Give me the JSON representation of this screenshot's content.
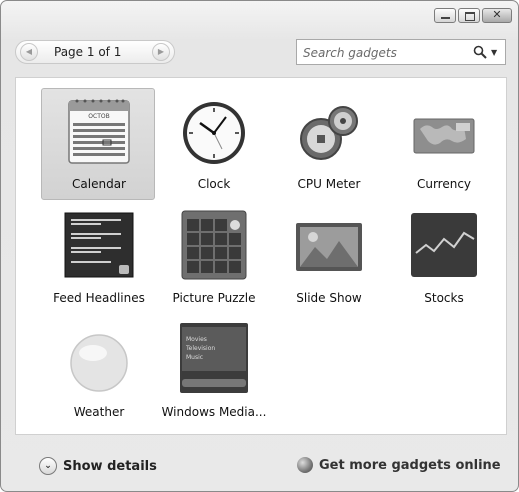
{
  "window": {
    "minimize_glyph": "—",
    "maximize_glyph": "□",
    "close_glyph": "✕"
  },
  "toolbar": {
    "prev_glyph": "◀",
    "next_glyph": "▶",
    "page_label": "Page 1 of 1",
    "search_placeholder": "Search gadgets",
    "search_value": ""
  },
  "gadgets": [
    {
      "label": "Calendar",
      "icon": "calendar-icon",
      "selected": true
    },
    {
      "label": "Clock",
      "icon": "clock-icon"
    },
    {
      "label": "CPU Meter",
      "icon": "cpu-meter-icon"
    },
    {
      "label": "Currency",
      "icon": "currency-icon"
    },
    {
      "label": "Feed Headlines",
      "icon": "feed-headlines-icon"
    },
    {
      "label": "Picture Puzzle",
      "icon": "picture-puzzle-icon"
    },
    {
      "label": "Slide Show",
      "icon": "slide-show-icon"
    },
    {
      "label": "Stocks",
      "icon": "stocks-icon"
    },
    {
      "label": "Weather",
      "icon": "weather-icon"
    },
    {
      "label": "Windows Media...",
      "icon": "windows-media-center-icon"
    }
  ],
  "calendar_thumb": {
    "month": "OCTOB"
  },
  "media_thumb": {
    "items": [
      "Movies",
      "Television",
      "Music"
    ]
  },
  "footer": {
    "show_details_glyph": "⌄",
    "show_details_label": "Show details",
    "get_more_label": "Get more gadgets online"
  }
}
